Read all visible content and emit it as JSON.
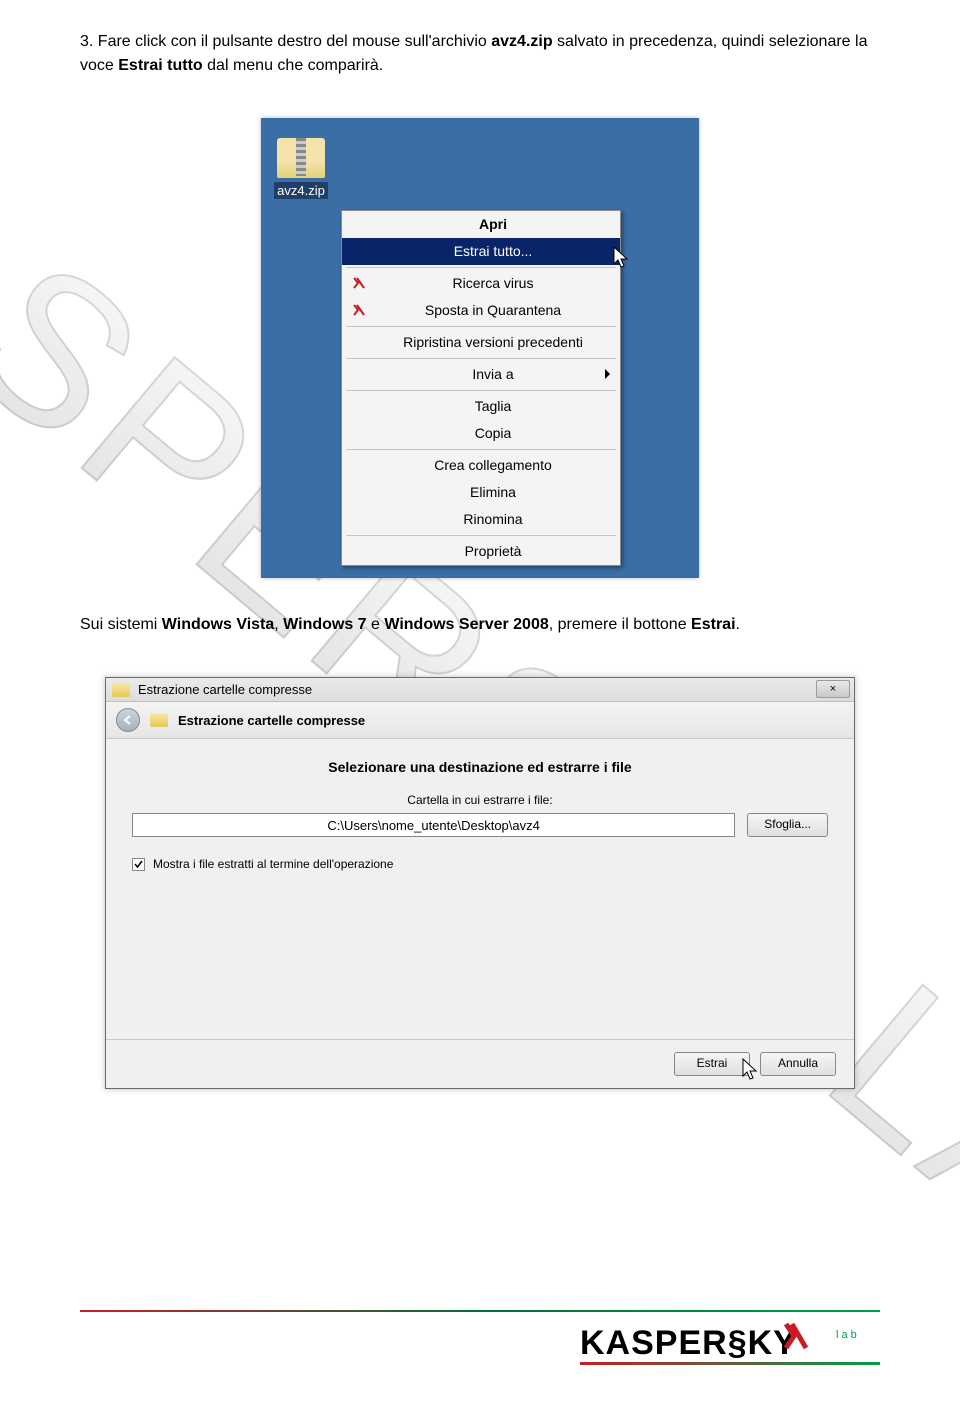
{
  "instruction": {
    "prefix": "3. Fare click con il pulsante destro del mouse sull'archivio ",
    "file": "avz4.zip",
    "mid": " salvato in precedenza, quindi selezionare la voce ",
    "action": "Estrai tutto",
    "suffix": " dal menu che comparirà."
  },
  "desktop": {
    "zip_label": "avz4.zip"
  },
  "context_menu": {
    "open": "Apri",
    "extract_all": "Estrai tutto...",
    "scan_virus": "Ricerca virus",
    "quarantine": "Sposta in Quarantena",
    "restore_versions": "Ripristina versioni precedenti",
    "send_to": "Invia a",
    "cut": "Taglia",
    "copy": "Copia",
    "create_shortcut": "Crea collegamento",
    "delete": "Elimina",
    "rename": "Rinomina",
    "properties": "Proprietà"
  },
  "caption2": {
    "prefix": "Sui sistemi ",
    "b1": "Windows Vista",
    "sep1": ", ",
    "b2": "Windows 7",
    "mid": " e ",
    "b3": "Windows Server 2008",
    "mid2": ", premere il bottone ",
    "b4": "Estrai",
    "suffix": "."
  },
  "wizard": {
    "title": "Estrazione cartelle compresse",
    "header": "Estrazione cartelle compresse",
    "heading": "Selezionare una destinazione ed estrarre i file",
    "path_label": "Cartella in cui estrarre i file:",
    "path_value": "C:\\Users\\nome_utente\\Desktop\\avz4",
    "browse": "Sfoglia...",
    "show_files": "Mostra i file estratti al termine dell'operazione",
    "extract_btn": "Estrai",
    "cancel_btn": "Annulla",
    "close_x": "×"
  },
  "watermark": "KASPERSKY LAB",
  "logo_text": "KASPERSKY"
}
